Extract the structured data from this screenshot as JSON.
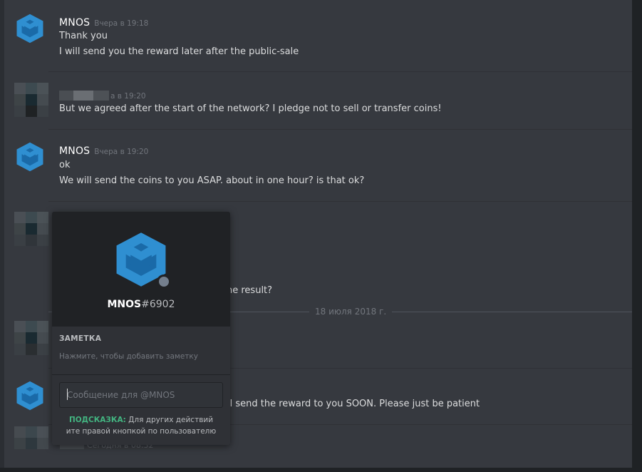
{
  "messages": [
    {
      "author": "MNOS",
      "timestamp": "Вчера в 19:18",
      "lines": [
        "Thank you",
        "I will send you the reward later after the public-sale"
      ]
    },
    {
      "author": "",
      "timestamp": "а в 19:20",
      "lines": [
        "But we agreed after the start of the network? I pledge not to sell or transfer coins!"
      ]
    },
    {
      "author": "MNOS",
      "timestamp": "Вчера в 19:20",
      "lines": [
        "ok",
        "We will send the coins to you ASAP. about  in one hour? is that ok?"
      ]
    },
    {
      "partial_line": "he result?"
    },
    {
      "partial_line": "ll send the reward to you SOON. Please just be patient"
    },
    {
      "partial_timestamp": "Сегодня в 08:32"
    }
  ],
  "date_separator": "18 июля 2018 г.",
  "popout": {
    "username": "MNOS",
    "discriminator": "#6902",
    "note_title": "ЗАМЕТКА",
    "note_hint": "Нажмите, чтобы добавить заметку",
    "message_placeholder": "Сообщение для @MNOS",
    "tip_label": "ПОДСКАЗКА:",
    "tip_line1": "Для других действий",
    "tip_line2": "ите правой кнопкой по пользователю"
  },
  "colors": {
    "chat_background": "#36393f",
    "popout_header": "#202225",
    "popout_body": "#2f3136",
    "logo_light_blue": "#2f8fd1",
    "logo_dark_blue": "#1a6aa8",
    "status_offline": "#747f8d",
    "tip_green": "#43b581"
  },
  "icons": {
    "avatar": "mnos-logo-icon",
    "status": "offline-status-icon"
  }
}
